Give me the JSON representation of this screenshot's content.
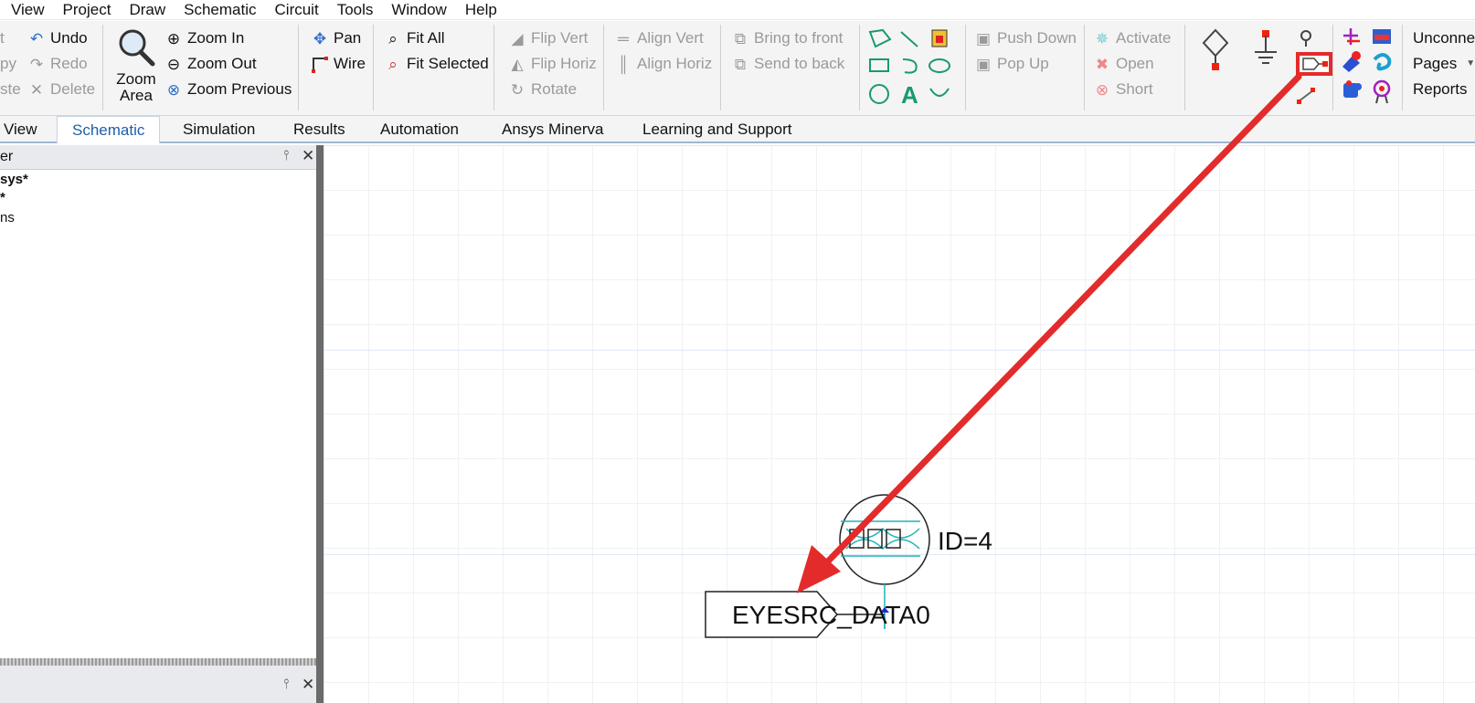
{
  "menubar": [
    "View",
    "Project",
    "Draw",
    "Schematic",
    "Circuit",
    "Tools",
    "Window",
    "Help"
  ],
  "edit_group": {
    "cut": "t",
    "copy": "py",
    "paste": "ste",
    "undo": "Undo",
    "redo": "Redo",
    "delete": "Delete"
  },
  "zoom_group": {
    "zoom_area_line1": "Zoom",
    "zoom_area_line2": "Area",
    "zoom_in": "Zoom In",
    "zoom_out": "Zoom Out",
    "zoom_previous": "Zoom Previous"
  },
  "tools_group": {
    "pan": "Pan",
    "wire": "Wire"
  },
  "fit_group": {
    "fit_all": "Fit All",
    "fit_selected": "Fit Selected"
  },
  "flip_group": {
    "flip_vert": "Flip Vert",
    "flip_horiz": "Flip Horiz",
    "rotate": "Rotate"
  },
  "align_group": {
    "align_vert": "Align Vert",
    "align_horiz": "Align Horiz"
  },
  "order_group": {
    "bring_to_front": "Bring to front",
    "send_to_back": "Send to back"
  },
  "hierarchy_group": {
    "push_down": "Push Down",
    "pop_up": "Pop Up"
  },
  "state_group": {
    "activate": "Activate",
    "open": "Open",
    "short": "Short"
  },
  "right_group": {
    "unconnected": "Unconne",
    "pages": "Pages",
    "reports": "Reports"
  },
  "tabs": [
    "View",
    "Schematic",
    "Simulation",
    "Results",
    "Automation",
    "Ansys Minerva",
    "Learning and Support"
  ],
  "left_pane": {
    "title": "er",
    "tree": [
      "sys*",
      "*",
      "ns"
    ]
  },
  "schematic": {
    "component_id": "ID=4",
    "port_label": "EYESRC_DATA0"
  },
  "colors": {
    "annotation_red": "#e32b2b",
    "wire_teal": "#1fb5b5",
    "accent_blue": "#1f5ea8"
  }
}
